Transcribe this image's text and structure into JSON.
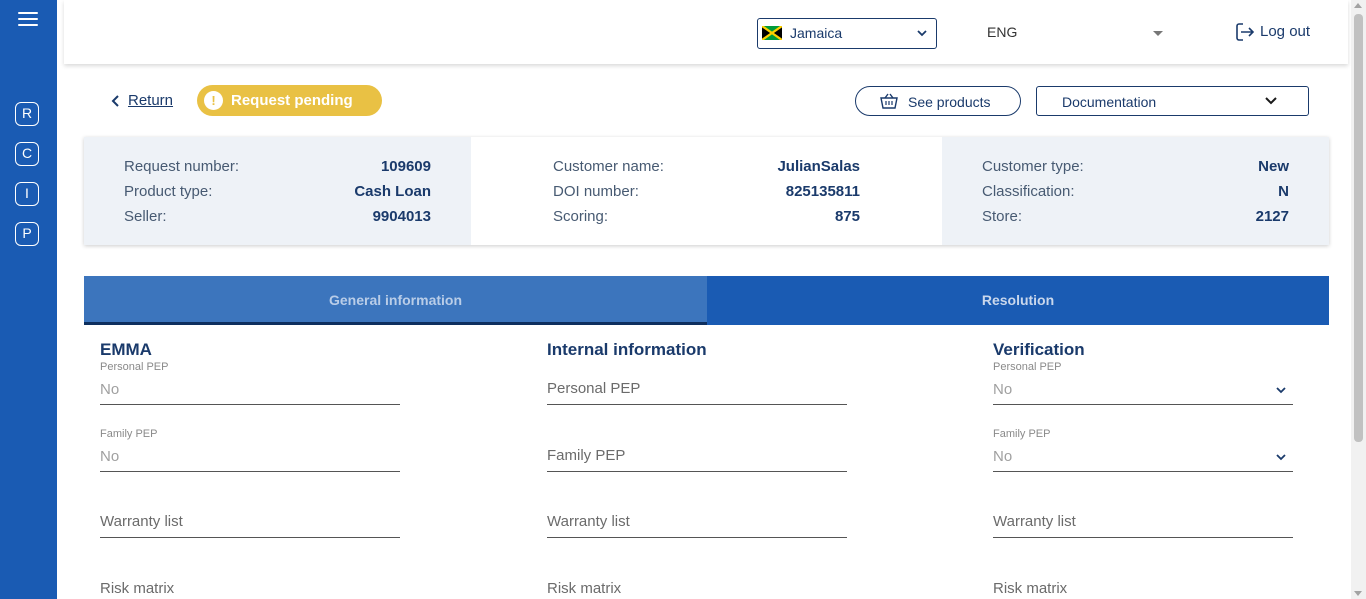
{
  "sidebar": {
    "items": [
      {
        "letter": "R"
      },
      {
        "letter": "C"
      },
      {
        "letter": "I"
      },
      {
        "letter": "P"
      }
    ]
  },
  "header": {
    "country": "Jamaica",
    "language": "ENG",
    "logout_label": "Log out"
  },
  "actions": {
    "return_label": "Return",
    "status_label": "Request pending",
    "status_color": "#e9c144",
    "see_products_label": "See products",
    "documentation_label": "Documentation"
  },
  "summary": {
    "col1": [
      {
        "label": "Request number:",
        "value": "109609"
      },
      {
        "label": "Product type:",
        "value": "Cash Loan"
      },
      {
        "label": "Seller:",
        "value": "9904013"
      }
    ],
    "col2": [
      {
        "label": "Customer name:",
        "value": "JulianSalas"
      },
      {
        "label": "DOI number:",
        "value": "825135811"
      },
      {
        "label": "Scoring:",
        "value": "875"
      }
    ],
    "col3": [
      {
        "label": "Customer type:",
        "value": "New"
      },
      {
        "label": "Classification:",
        "value": "N"
      },
      {
        "label": "Store:",
        "value": "2127"
      }
    ]
  },
  "tabs": [
    {
      "label": "General information"
    },
    {
      "label": "Resolution"
    }
  ],
  "sections": {
    "emma": {
      "title": "EMMA",
      "personal_pep_label": "Personal PEP",
      "personal_pep_value": "No",
      "family_pep_label": "Family PEP",
      "family_pep_value": "No",
      "warranty_list": "Warranty list",
      "risk_matrix": "Risk matrix"
    },
    "internal": {
      "title": "Internal information",
      "personal_pep": "Personal PEP",
      "family_pep": "Family PEP",
      "warranty_list": "Warranty list",
      "risk_matrix": "Risk matrix"
    },
    "verification": {
      "title": "Verification",
      "personal_pep_label": "Personal PEP",
      "personal_pep_value": "No",
      "family_pep_label": "Family PEP",
      "family_pep_value": "No",
      "warranty_list": "Warranty list",
      "risk_matrix": "Risk matrix"
    }
  },
  "colors": {
    "sidebar": "#1a5bb3",
    "primary_text": "#1a3a6b",
    "tab_active": "#3c75bd",
    "tab_inactive": "#1a5bb3"
  }
}
